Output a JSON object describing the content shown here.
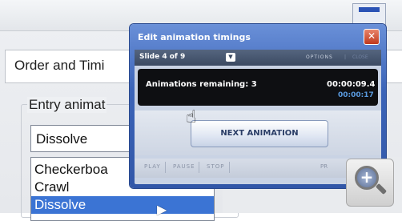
{
  "background": {
    "order_tab": "Order and Timi",
    "order_tab_suffix": "i",
    "entry_label": "Entry animat",
    "dropdown_value": "Dissolve",
    "list_items": [
      "Checkerboa",
      "Crawl",
      "Dissolve"
    ]
  },
  "dialog": {
    "title": "Edit animation timings",
    "close_glyph": "✕",
    "slide_selector": "Slide 4 of 9",
    "options_label": "OPTIONS",
    "separator": "|",
    "close_label": "CLOSE",
    "remaining": "Animations remaining: 3",
    "time_elapsed": "00:00:09.4",
    "time_total": "00:00:17",
    "next_button": "NEXT ANIMATION",
    "controls": [
      "PLAY",
      "PAUSE",
      "STOP"
    ],
    "dim_control": "PR"
  },
  "icons": {
    "hand": "☝",
    "zoom": "+",
    "pointer": "▶"
  },
  "colors": {
    "dialog_blue": "#3b64b8",
    "close_red": "#c0391e",
    "selection_blue": "#3b74d4",
    "time_accent": "#5a9be0"
  }
}
